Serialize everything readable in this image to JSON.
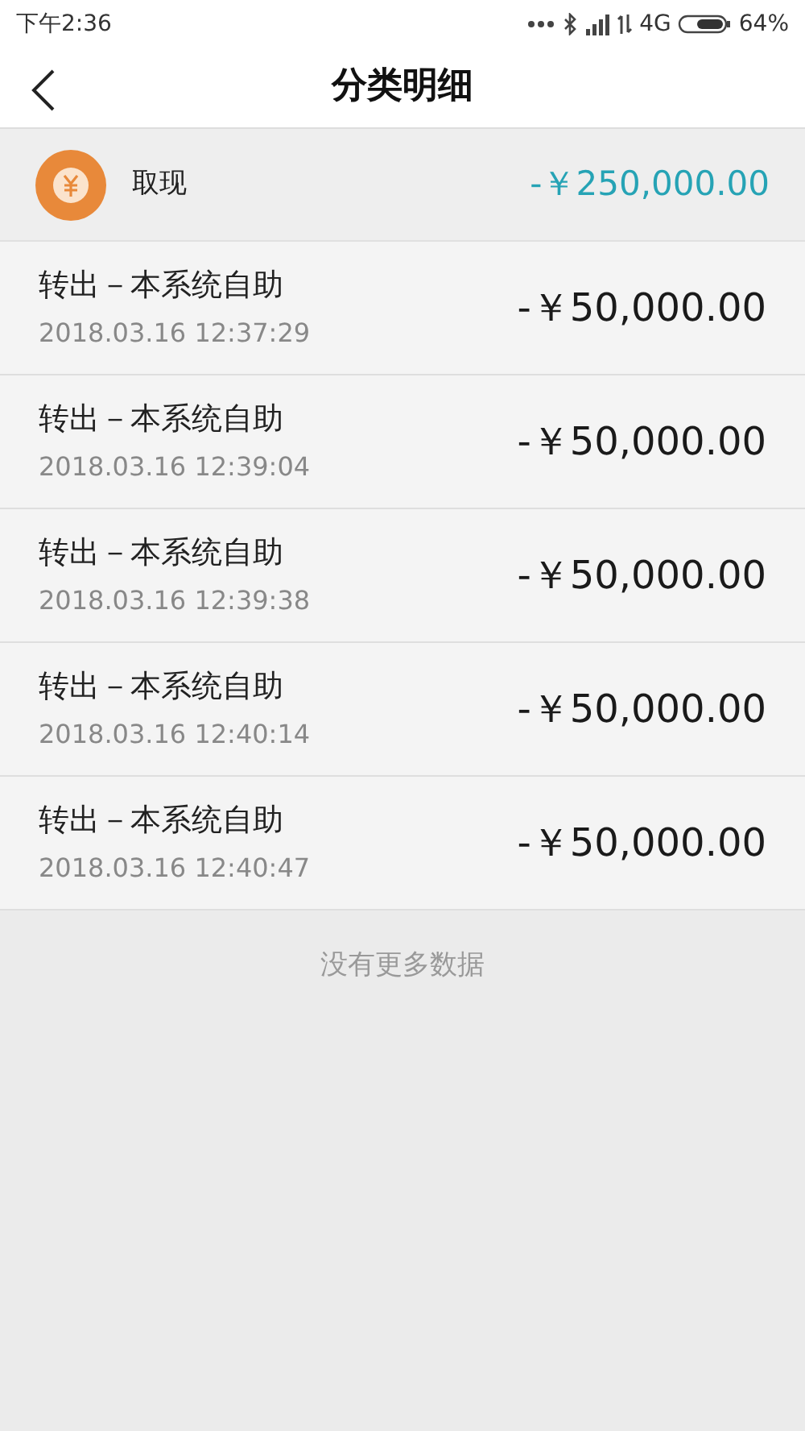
{
  "status_bar": {
    "time": "下午2:36",
    "network": "4G",
    "battery": "64%"
  },
  "header": {
    "title": "分类明细"
  },
  "summary": {
    "label": "取现",
    "amount": "-￥250,000.00"
  },
  "rows": [
    {
      "title": "转出－本系统自助",
      "time": "2018.03.16 12:37:29",
      "amount": "-￥50,000.00"
    },
    {
      "title": "转出－本系统自助",
      "time": "2018.03.16 12:39:04",
      "amount": "-￥50,000.00"
    },
    {
      "title": "转出－本系统自助",
      "time": "2018.03.16 12:39:38",
      "amount": "-￥50,000.00"
    },
    {
      "title": "转出－本系统自助",
      "time": "2018.03.16 12:40:14",
      "amount": "-￥50,000.00"
    },
    {
      "title": "转出－本系统自助",
      "time": "2018.03.16 12:40:47",
      "amount": "-￥50,000.00"
    }
  ],
  "footer": "没有更多数据"
}
